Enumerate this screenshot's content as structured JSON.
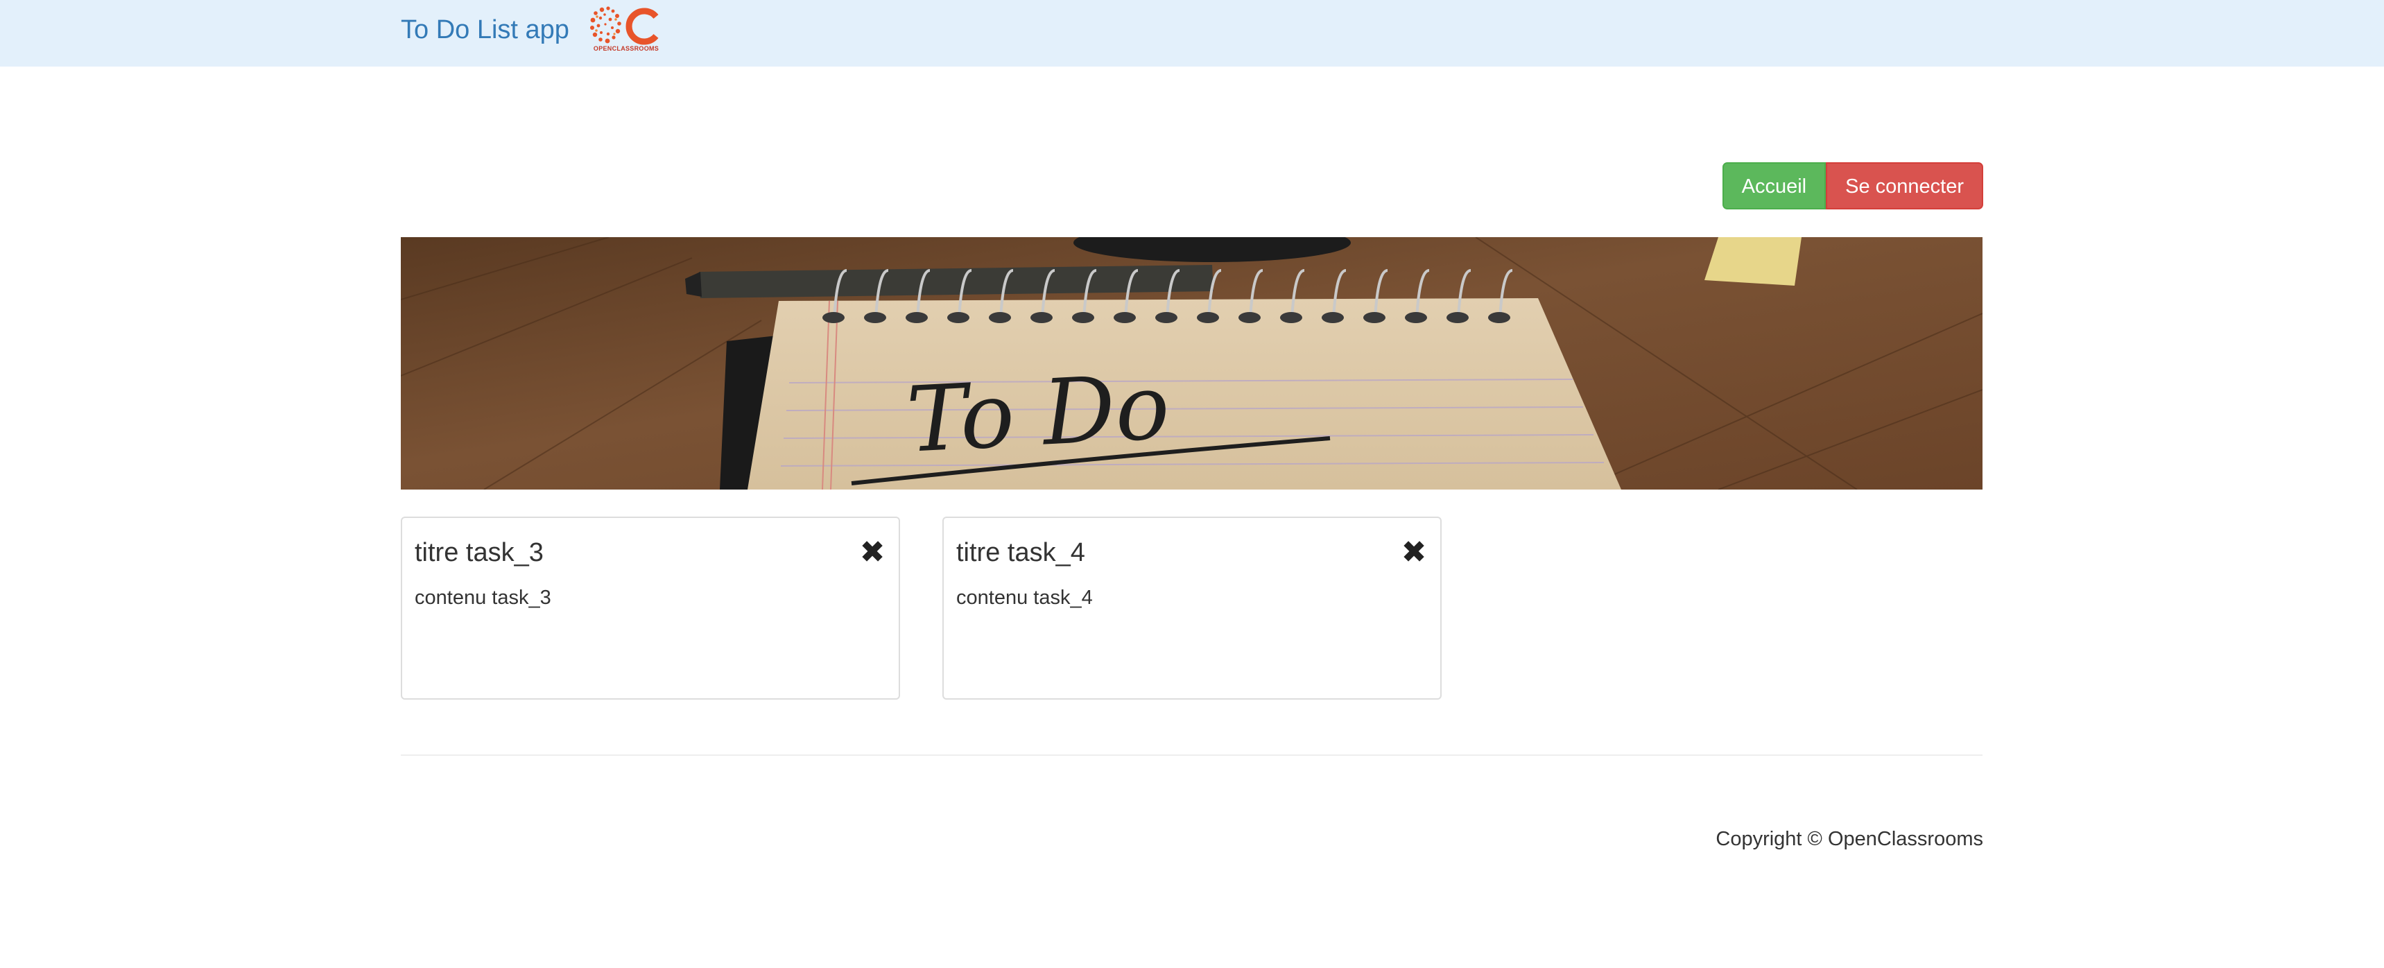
{
  "navbar": {
    "brand": "To Do List app",
    "logo": {
      "name": "openclassrooms-logo",
      "letters": "OC",
      "caption": "OPENCLASSROOMS"
    }
  },
  "actions": {
    "home_label": "Accueil",
    "login_label": "Se connecter"
  },
  "hero": {
    "handwriting": "To Do"
  },
  "tasks": [
    {
      "title": "titre task_3",
      "content": "contenu task_3",
      "remove_icon": "close-icon"
    },
    {
      "title": "titre task_4",
      "content": "contenu task_4",
      "remove_icon": "close-icon"
    }
  ],
  "footer": {
    "copyright": "Copyright © OpenClassrooms"
  },
  "colors": {
    "navbar_bg": "#e3f0fb",
    "brand": "#337ab7",
    "success": "#5cb85c",
    "danger": "#d9534f"
  }
}
